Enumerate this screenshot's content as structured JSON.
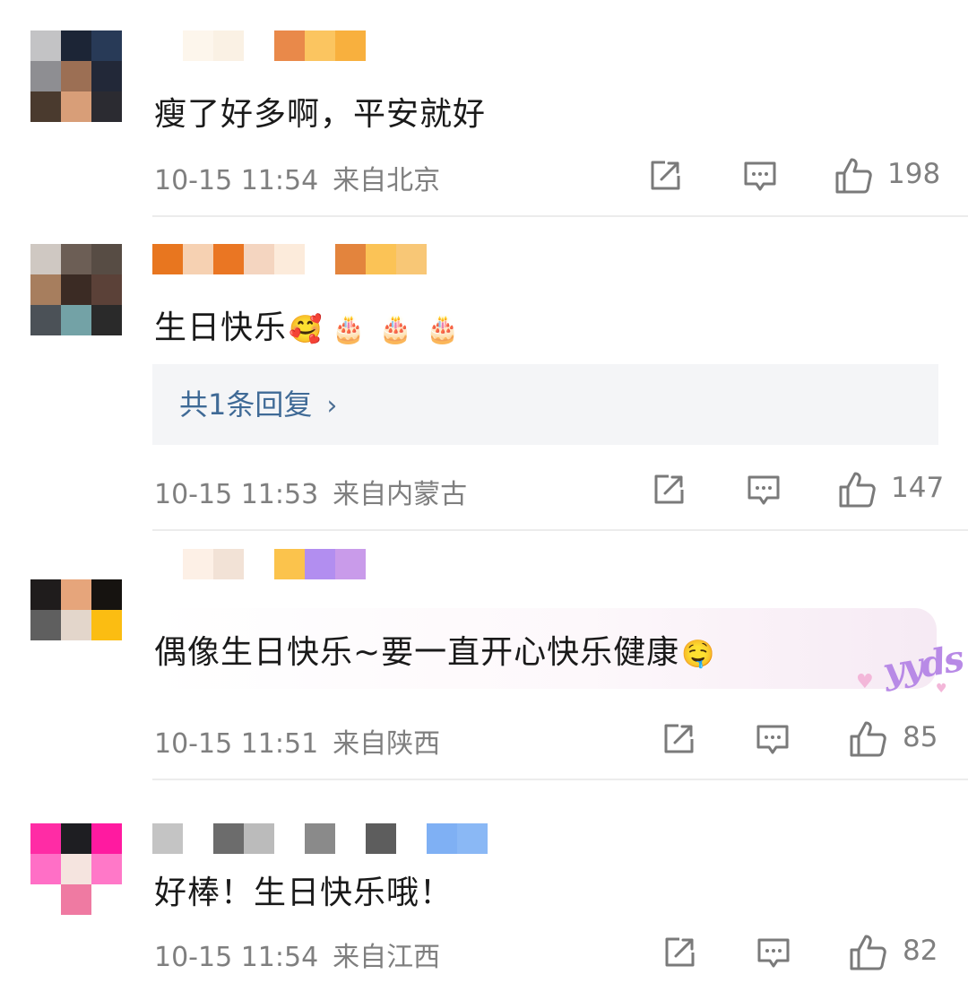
{
  "comments": [
    {
      "text": "瘦了好多啊，平安就好",
      "time": "10-15 11:54",
      "location": "来自北京",
      "likes": "198",
      "avatar_colors": [
        "#c3c3c5",
        "#1c2536",
        "#283a57",
        "#8e8e92",
        "#9c6f54",
        "#222838",
        "#4a3a2e",
        "#d89e78",
        "#2b2b31"
      ],
      "name_colors": [
        "#ffffff",
        "#fdf6ec",
        "#faf1e4",
        "#ffffff",
        "#e9894a",
        "#fbc560",
        "#f8b03e"
      ]
    },
    {
      "text": "生日快乐",
      "emoji": [
        "🥰",
        "🎂",
        "🎂",
        "🎂"
      ],
      "reply_label": "共1条回复",
      "reply_chevron": "›",
      "time": "10-15 11:53",
      "location": "来自内蒙古",
      "likes": "147",
      "avatar_colors": [
        "#cfc8c2",
        "#6c5e55",
        "#574c44",
        "#a77e5e",
        "#3b2b24",
        "#5b4138",
        "#4b5157",
        "#73a2a6",
        "#2a2a2a"
      ],
      "name_colors": [
        "#e8761f",
        "#f6d1b2",
        "#ea7623",
        "#f4d5c0",
        "#fcebdb",
        "#ffffff",
        "#e3843d",
        "#fbc356",
        "#f8c776"
      ]
    },
    {
      "text": "偶像生日快乐~要一直开心快乐健康",
      "emoji": [
        "🤤"
      ],
      "decoration": "yyds",
      "time": "10-15 11:51",
      "location": "来自陕西",
      "likes": "85",
      "avatar_colors": [
        "#ffffff",
        "#ffffff",
        "#ffffff",
        "#1f1c1c",
        "#e6a57b",
        "#161310",
        "#5f5f5f",
        "#e3d6cb",
        "#fbbd12"
      ],
      "name_colors": [
        "#ffffff",
        "#fdf0e6",
        "#f2e2d6",
        "#ffffff",
        "#fbc34c",
        "#b28ef0",
        "#c99bea"
      ]
    },
    {
      "text": "好棒！生日快乐哦！",
      "time": "10-15 11:54",
      "location": "来自江西",
      "likes": "82",
      "avatar_colors": [
        "#ff2ca5",
        "#1e1e22",
        "#ff1aa0",
        "#ff6fc6",
        "#f5e4df",
        "#ff78c8",
        "#ffffff",
        "#ef7aa2",
        "#ffffff"
      ],
      "name_colors": [
        "#c4c4c4",
        "#ffffff",
        "#6c6c6c",
        "#bbbbbb",
        "#ffffff",
        "#8a8a8a",
        "#ffffff",
        "#5d5d5d",
        "#ffffff",
        "#7fb0f4",
        "#8ab8f5"
      ]
    }
  ],
  "icons": {
    "share": "share-icon",
    "comment": "comment-icon",
    "like": "thumbs-up-icon"
  },
  "colors": {
    "text_primary": "#1a1a1a",
    "text_meta": "#7f7f7f",
    "reply_link": "#3f6a96",
    "reply_bg": "#f4f5f7",
    "divider": "#ececec"
  }
}
